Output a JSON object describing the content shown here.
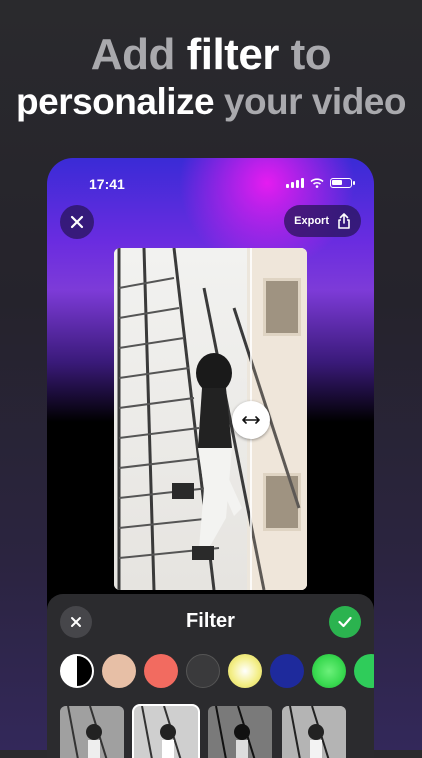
{
  "headline": {
    "line1_part1": "Add",
    "line1_bold": "filter",
    "line1_part2": "to",
    "line2_part1": "personalize",
    "line2_part2": "your video"
  },
  "status_bar": {
    "time": "17:41"
  },
  "toolbar": {
    "export_label": "Export"
  },
  "filter_panel": {
    "title": "Filter",
    "swatches": [
      {
        "name": "contrast",
        "color": "#ffffff"
      },
      {
        "name": "peach",
        "color": "#e7bfa6"
      },
      {
        "name": "coral",
        "color": "#f26b60"
      },
      {
        "name": "charcoal",
        "color": "#3a3a3c"
      },
      {
        "name": "yellow-glow",
        "color": "#f4ef8a"
      },
      {
        "name": "navy",
        "color": "#1e2a9c"
      },
      {
        "name": "green-glow",
        "color": "#38d94f"
      },
      {
        "name": "green",
        "color": "#2fcc5a"
      }
    ],
    "thumbnail_count": 4,
    "selected_thumbnail": 1
  },
  "colors": {
    "accent_green": "#2bb34f",
    "gradient_top": "#3a2bd6",
    "gradient_magenta": "#e51cf0"
  }
}
